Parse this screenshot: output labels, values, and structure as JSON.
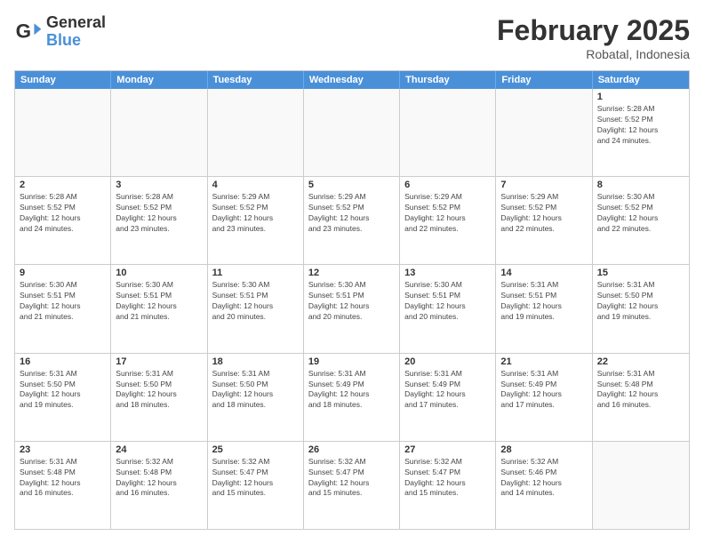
{
  "logo": {
    "general": "General",
    "blue": "Blue"
  },
  "title": "February 2025",
  "location": "Robatal, Indonesia",
  "days": [
    "Sunday",
    "Monday",
    "Tuesday",
    "Wednesday",
    "Thursday",
    "Friday",
    "Saturday"
  ],
  "rows": [
    [
      {
        "day": "",
        "info": ""
      },
      {
        "day": "",
        "info": ""
      },
      {
        "day": "",
        "info": ""
      },
      {
        "day": "",
        "info": ""
      },
      {
        "day": "",
        "info": ""
      },
      {
        "day": "",
        "info": ""
      },
      {
        "day": "1",
        "info": "Sunrise: 5:28 AM\nSunset: 5:52 PM\nDaylight: 12 hours\nand 24 minutes."
      }
    ],
    [
      {
        "day": "2",
        "info": "Sunrise: 5:28 AM\nSunset: 5:52 PM\nDaylight: 12 hours\nand 24 minutes."
      },
      {
        "day": "3",
        "info": "Sunrise: 5:28 AM\nSunset: 5:52 PM\nDaylight: 12 hours\nand 23 minutes."
      },
      {
        "day": "4",
        "info": "Sunrise: 5:29 AM\nSunset: 5:52 PM\nDaylight: 12 hours\nand 23 minutes."
      },
      {
        "day": "5",
        "info": "Sunrise: 5:29 AM\nSunset: 5:52 PM\nDaylight: 12 hours\nand 23 minutes."
      },
      {
        "day": "6",
        "info": "Sunrise: 5:29 AM\nSunset: 5:52 PM\nDaylight: 12 hours\nand 22 minutes."
      },
      {
        "day": "7",
        "info": "Sunrise: 5:29 AM\nSunset: 5:52 PM\nDaylight: 12 hours\nand 22 minutes."
      },
      {
        "day": "8",
        "info": "Sunrise: 5:30 AM\nSunset: 5:52 PM\nDaylight: 12 hours\nand 22 minutes."
      }
    ],
    [
      {
        "day": "9",
        "info": "Sunrise: 5:30 AM\nSunset: 5:51 PM\nDaylight: 12 hours\nand 21 minutes."
      },
      {
        "day": "10",
        "info": "Sunrise: 5:30 AM\nSunset: 5:51 PM\nDaylight: 12 hours\nand 21 minutes."
      },
      {
        "day": "11",
        "info": "Sunrise: 5:30 AM\nSunset: 5:51 PM\nDaylight: 12 hours\nand 20 minutes."
      },
      {
        "day": "12",
        "info": "Sunrise: 5:30 AM\nSunset: 5:51 PM\nDaylight: 12 hours\nand 20 minutes."
      },
      {
        "day": "13",
        "info": "Sunrise: 5:30 AM\nSunset: 5:51 PM\nDaylight: 12 hours\nand 20 minutes."
      },
      {
        "day": "14",
        "info": "Sunrise: 5:31 AM\nSunset: 5:51 PM\nDaylight: 12 hours\nand 19 minutes."
      },
      {
        "day": "15",
        "info": "Sunrise: 5:31 AM\nSunset: 5:50 PM\nDaylight: 12 hours\nand 19 minutes."
      }
    ],
    [
      {
        "day": "16",
        "info": "Sunrise: 5:31 AM\nSunset: 5:50 PM\nDaylight: 12 hours\nand 19 minutes."
      },
      {
        "day": "17",
        "info": "Sunrise: 5:31 AM\nSunset: 5:50 PM\nDaylight: 12 hours\nand 18 minutes."
      },
      {
        "day": "18",
        "info": "Sunrise: 5:31 AM\nSunset: 5:50 PM\nDaylight: 12 hours\nand 18 minutes."
      },
      {
        "day": "19",
        "info": "Sunrise: 5:31 AM\nSunset: 5:49 PM\nDaylight: 12 hours\nand 18 minutes."
      },
      {
        "day": "20",
        "info": "Sunrise: 5:31 AM\nSunset: 5:49 PM\nDaylight: 12 hours\nand 17 minutes."
      },
      {
        "day": "21",
        "info": "Sunrise: 5:31 AM\nSunset: 5:49 PM\nDaylight: 12 hours\nand 17 minutes."
      },
      {
        "day": "22",
        "info": "Sunrise: 5:31 AM\nSunset: 5:48 PM\nDaylight: 12 hours\nand 16 minutes."
      }
    ],
    [
      {
        "day": "23",
        "info": "Sunrise: 5:31 AM\nSunset: 5:48 PM\nDaylight: 12 hours\nand 16 minutes."
      },
      {
        "day": "24",
        "info": "Sunrise: 5:32 AM\nSunset: 5:48 PM\nDaylight: 12 hours\nand 16 minutes."
      },
      {
        "day": "25",
        "info": "Sunrise: 5:32 AM\nSunset: 5:47 PM\nDaylight: 12 hours\nand 15 minutes."
      },
      {
        "day": "26",
        "info": "Sunrise: 5:32 AM\nSunset: 5:47 PM\nDaylight: 12 hours\nand 15 minutes."
      },
      {
        "day": "27",
        "info": "Sunrise: 5:32 AM\nSunset: 5:47 PM\nDaylight: 12 hours\nand 15 minutes."
      },
      {
        "day": "28",
        "info": "Sunrise: 5:32 AM\nSunset: 5:46 PM\nDaylight: 12 hours\nand 14 minutes."
      },
      {
        "day": "",
        "info": ""
      }
    ]
  ]
}
